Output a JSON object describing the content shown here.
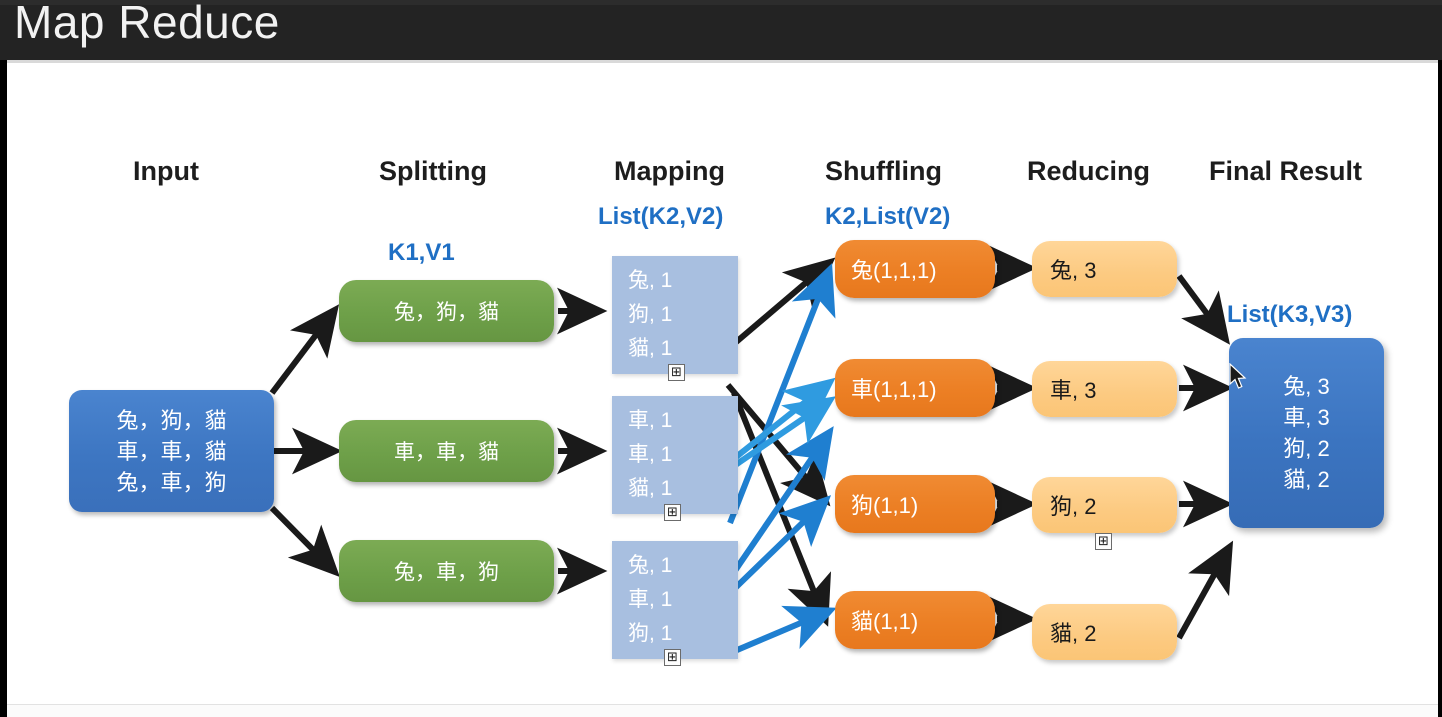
{
  "window": {
    "title": "Map Reduce"
  },
  "diagram": {
    "headers": [
      {
        "label": "Input"
      },
      {
        "label": "Splitting"
      },
      {
        "label": "Mapping"
      },
      {
        "label": "Shuffling"
      },
      {
        "label": "Reducing"
      },
      {
        "label": "Final Result"
      }
    ],
    "sub_labels": {
      "splitting": "K1,V1",
      "mapping": "List(K2,V2)",
      "shuffling": "K2,List(V2)",
      "final": "List(K3,V3)"
    },
    "input_box": {
      "text": "兔，狗，貓\n車，車，貓\n兔，車，狗",
      "color": "#3d76c2"
    },
    "splitting_boxes": [
      {
        "text": "兔，狗，貓"
      },
      {
        "text": "車，車，貓"
      },
      {
        "text": "兔，車，狗"
      }
    ],
    "mapping_boxes": [
      {
        "text": "兔, 1\n狗, 1\n貓, 1"
      },
      {
        "text": "車, 1\n車, 1\n貓, 1"
      },
      {
        "text": "兔, 1\n車, 1\n狗, 1"
      }
    ],
    "shuffling_boxes": [
      {
        "text": "兔(1,1,1)"
      },
      {
        "text": "車(1,1,1)"
      },
      {
        "text": "狗(1,1)"
      },
      {
        "text": "貓(1,1)"
      }
    ],
    "reducing_boxes": [
      {
        "text": "兔, 3"
      },
      {
        "text": "車, 3"
      },
      {
        "text": "狗, 2"
      },
      {
        "text": "貓, 2"
      }
    ],
    "final_box": {
      "text": "兔, 3\n車, 3\n狗, 2\n貓, 2"
    },
    "expand_markers": [
      {
        "glyph": "⊞"
      },
      {
        "glyph": "⊞"
      },
      {
        "glyph": "⊞"
      },
      {
        "glyph": "⊞"
      }
    ],
    "colors": {
      "input_blue": "#3d76c2",
      "split_green": "#6ea049",
      "map_blue": "#a8bfe0",
      "shuffle_orange": "#ec7f24",
      "reduce_peach": "#fcca81",
      "final_blue": "#3b74c0",
      "label_blue": "#1f6fc4",
      "arrow_black": "#1a1a1a",
      "arrow_blue": "#1f7fd0",
      "arrow_lightblue": "#2f9be0",
      "title_bar": "#232323"
    }
  }
}
